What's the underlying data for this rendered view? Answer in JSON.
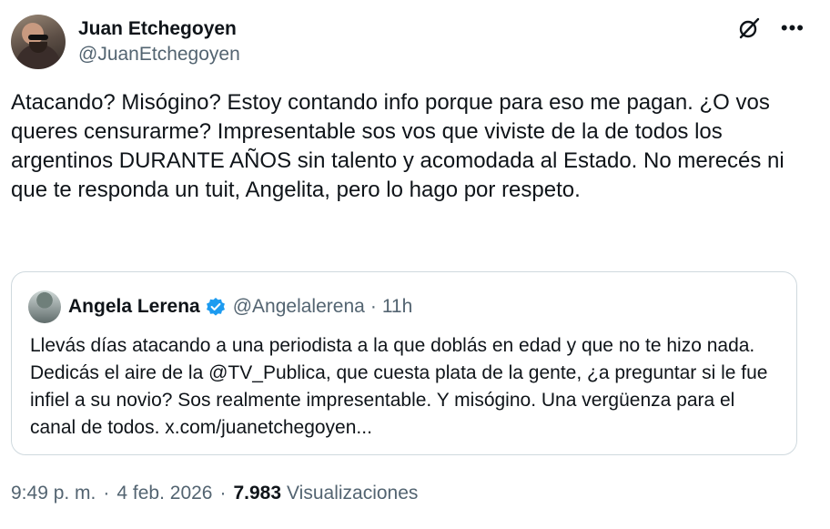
{
  "author": {
    "display_name": "Juan Etchegoyen",
    "handle": "@JuanEtchegoyen"
  },
  "tweet": {
    "text": "Atacando? Misógino? Estoy contando info porque para eso me pagan. ¿O vos queres censurarme? Impresentable sos vos que viviste de la de todos los argentinos DURANTE AÑOS sin talento y acomodada al Estado. No merecés ni que te responda un tuit, Angelita, pero lo hago por respeto."
  },
  "quoted": {
    "display_name": "Angela Lerena",
    "handle": "@Angelalerena",
    "separator": "·",
    "time": "11h",
    "text": "Llevás días atacando a una periodista a la que doblás en edad y que no te hizo nada. Dedicás el aire de la @TV_Publica, que cuesta plata de la gente, ¿a preguntar si le fue infiel a su novio? Sos realmente impresentable. Y misógino. Una vergüenza para el canal de todos. x.com/juanetchegoyen..."
  },
  "meta": {
    "time": "9:49 p. m.",
    "sep1": "·",
    "date": "4 feb. 2026",
    "sep2": "·",
    "views_count": "7.983",
    "views_label": "Visualizaciones"
  },
  "icons": {
    "grok": "grok-icon",
    "more": "more-icon",
    "verified": "verified-badge-icon"
  },
  "colors": {
    "text": "#0f1419",
    "secondary": "#536471",
    "border": "#cfd9de",
    "verified": "#1d9bf0"
  }
}
